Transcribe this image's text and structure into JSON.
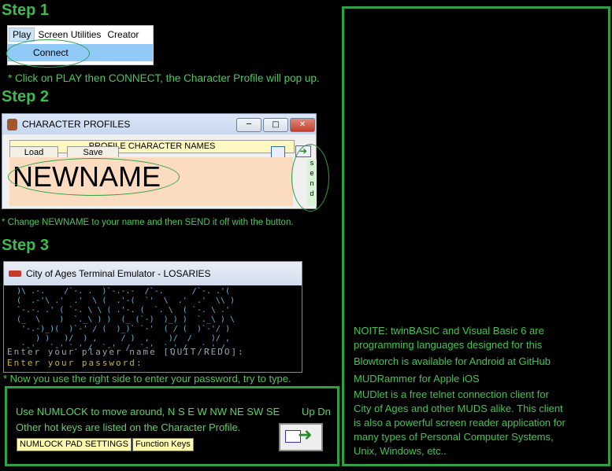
{
  "steps": {
    "step1": "Step 1",
    "step2": "Step 2",
    "step3": "Step 3"
  },
  "menu": {
    "items": [
      "Play",
      "Screen Utilities",
      "Creator"
    ],
    "dropdown_item": "Connect"
  },
  "hint1": "* Click on PLAY then CONNECT, the Character Profile will pop up.",
  "profile_window": {
    "title": "CHARACTER PROFILES",
    "header_tab": "PROFILE CHARACTER NAMES",
    "load_label": "Load",
    "save_label": "Save",
    "name_value": "NEWNAME",
    "send_letters": [
      "s",
      "e",
      "n",
      "d"
    ]
  },
  "hint2": "* Change NEWNAME to your name and then SEND it off with the button.",
  "terminal": {
    "title": "City of Ages Terminal Emulator - LOSARIES",
    "ascii_art": "  )\\ .-.    /`-. .  )`-.-.-  /`-.      /`-. .'(\n  (  .-'\\ .'  .'  \\ (  .'-(  `'  \\  .'  .'  \\\\ )\n  `-.-. .' ( `-. \\ \\ ( .'-. (  `. \\  ( `-. \\ .'\n  (_  \\    )  `._\\ ) )  (_ (`-)  )_) )  `._\\ ) \\\n   '-.-)_)(  )`-' / (  )_)` `-'  ( / (  )`-'/ )\n      ) )   )/  ) ,     / )  ,    )/  /    )/ ,\n   `-'   `-' `.' /  `-'  /  `-'  `.' /   `.' /",
    "prompt_name": "Enter your player name [QUIT/REDO]:",
    "prompt_password": "Enter your password:"
  },
  "hint3": "* Now you use the right side to enter your password, try to type.",
  "numlock": {
    "line1": "Use NUMLOCK to move around, N S E W NW NE SW SE",
    "updn": "Up Dn",
    "line2": "Other hot keys are listed on the Character Profile.",
    "btn1": "NUMLOCK PAD SETTINGS",
    "btn2": "Function Keys"
  },
  "right_panel": {
    "noite": "NOITE: twinBASIC and Visual Basic 6 are\nprogramming languages designed for this",
    "blowtorch": "Blowtorch is available for Android  at GitHub",
    "mudrammer": "MUDRammer for Apple iOS",
    "mudlet": "MUDlet is a free telnet connection client for\nCity of Ages and other MUDS alike. This client\nis also a powerful screen reader application for\nmany types of Personal Computer Systems,\nUnix, Windows, etc.."
  },
  "colors": {
    "green": "#2ea043",
    "text_green": "#4ec65c",
    "profile_bg": "#fcdcc0"
  }
}
